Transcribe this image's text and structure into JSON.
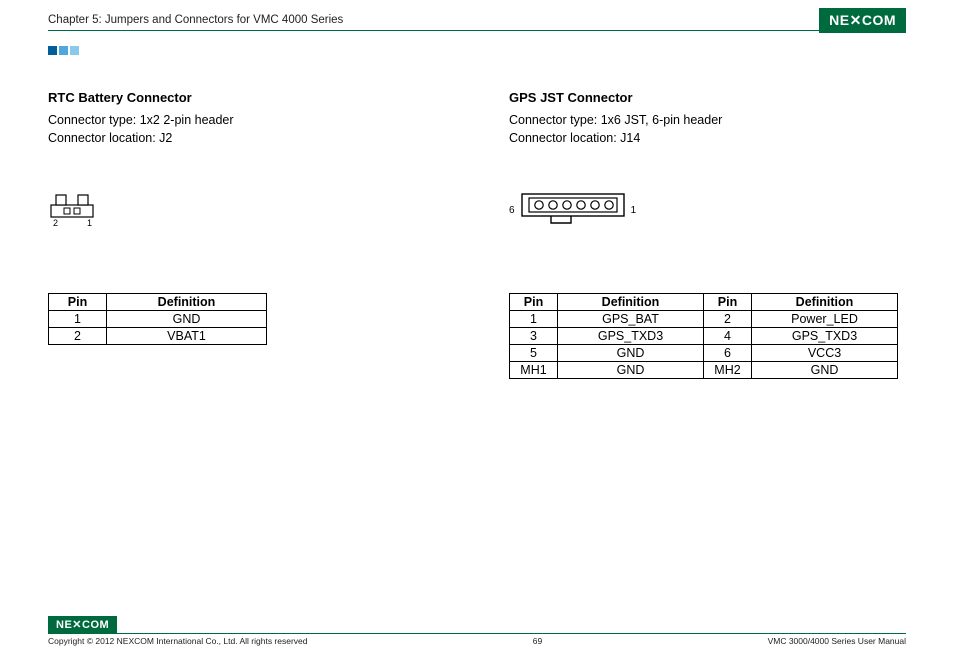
{
  "header": {
    "chapter_title": "Chapter 5: Jumpers and Connectors for VMC 4000 Series",
    "logo_text": "NE✕COM"
  },
  "left": {
    "title": "RTC Battery Connector",
    "type_line": "Connector type: 1x2 2-pin header",
    "loc_line": "Connector location: J2",
    "diagram": {
      "pin_left_label": "2",
      "pin_right_label": "1"
    },
    "table": {
      "headers": [
        "Pin",
        "Definition"
      ],
      "rows": [
        [
          "1",
          "GND"
        ],
        [
          "2",
          "VBAT1"
        ]
      ]
    }
  },
  "right": {
    "title": "GPS JST Connector",
    "type_line": "Connector type: 1x6 JST, 6-pin header",
    "loc_line": "Connector location: J14",
    "diagram": {
      "pin_left_label": "6",
      "pin_right_label": "1"
    },
    "table": {
      "headers": [
        "Pin",
        "Definition",
        "Pin",
        "Definition"
      ],
      "rows": [
        [
          "1",
          "GPS_BAT",
          "2",
          "Power_LED"
        ],
        [
          "3",
          "GPS_TXD3",
          "4",
          "GPS_TXD3"
        ],
        [
          "5",
          "GND",
          "6",
          "VCC3"
        ],
        [
          "MH1",
          "GND",
          "MH2",
          "GND"
        ]
      ]
    }
  },
  "footer": {
    "logo_text": "NE✕COM",
    "copyright": "Copyright © 2012 NEXCOM International Co., Ltd. All rights reserved",
    "page_number": "69",
    "manual_title": "VMC 3000/4000 Series User Manual"
  }
}
